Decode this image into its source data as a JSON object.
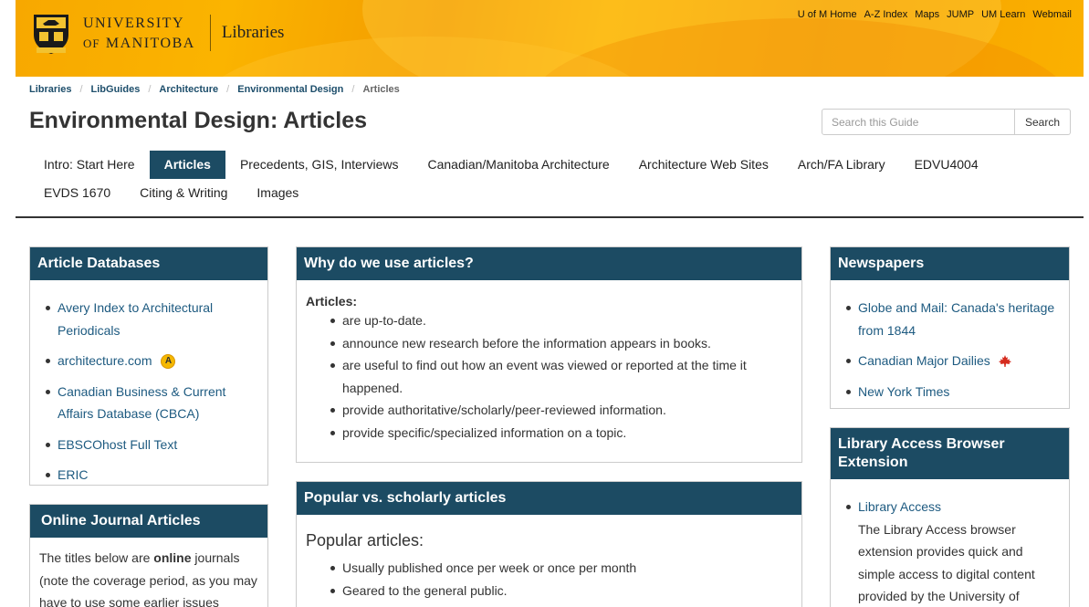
{
  "header": {
    "university_line1": "University",
    "university_line2_of": "of",
    "university_line2": "Manitoba",
    "libraries": "Libraries",
    "top_links": [
      "U of M Home",
      "A-Z Index",
      "Maps",
      "JUMP",
      "UM Learn",
      "Webmail"
    ],
    "brand_color": "#f7a800"
  },
  "breadcrumb": [
    "Libraries",
    "LibGuides",
    "Architecture",
    "Environmental Design",
    "Articles"
  ],
  "page_title": "Environmental Design: Articles",
  "search": {
    "placeholder": "Search this Guide",
    "button": "Search"
  },
  "tabs": {
    "row1": [
      "Intro: Start Here",
      "Articles",
      "Precedents, GIS, Interviews",
      "Canadian/Manitoba Architecture",
      "Architecture Web Sites",
      "Arch/FA Library",
      "EDVU4004"
    ],
    "row2": [
      "EVDS 1670",
      "Citing & Writing",
      "Images"
    ],
    "active": "Articles"
  },
  "article_databases": {
    "title": "Article Databases",
    "items": [
      "Avery Index to Architectural Periodicals",
      "architecture.com",
      "Canadian Business & Current Affairs Database (CBCA)",
      "EBSCOhost Full Text",
      "ERIC"
    ]
  },
  "online_journals": {
    "title": "Online Journal Articles",
    "text_before": "The titles below are ",
    "text_bold": "online",
    "text_after": " journals (note the coverage period, as you may have to use some earlier issues"
  },
  "why_articles": {
    "title": "Why do we use articles?",
    "subhead": "Articles:",
    "items": [
      "are up-to-date.",
      "announce new research before the information appears in books.",
      "are useful to find out how an event was viewed or reported at the time it happened.",
      "provide authoritative/scholarly/peer-reviewed information.",
      "provide specific/specialized information on a topic."
    ]
  },
  "popular_scholarly": {
    "title": "Popular vs. scholarly articles",
    "subhead": "Popular articles:",
    "items": [
      "Usually published once per week or once per month",
      "Geared to the general public."
    ]
  },
  "newspapers": {
    "title": "Newspapers",
    "items": [
      "Globe and Mail: Canada's heritage from 1844",
      "Canadian Major Dailies",
      "New York Times"
    ]
  },
  "library_access": {
    "title": "Library Access Browser Extension",
    "link": "Library Access",
    "text": "The Library Access browser extension provides quick and simple access to digital content provided by the University of"
  },
  "colors": {
    "accent": "#1c4b63",
    "link": "#1d5a80"
  }
}
